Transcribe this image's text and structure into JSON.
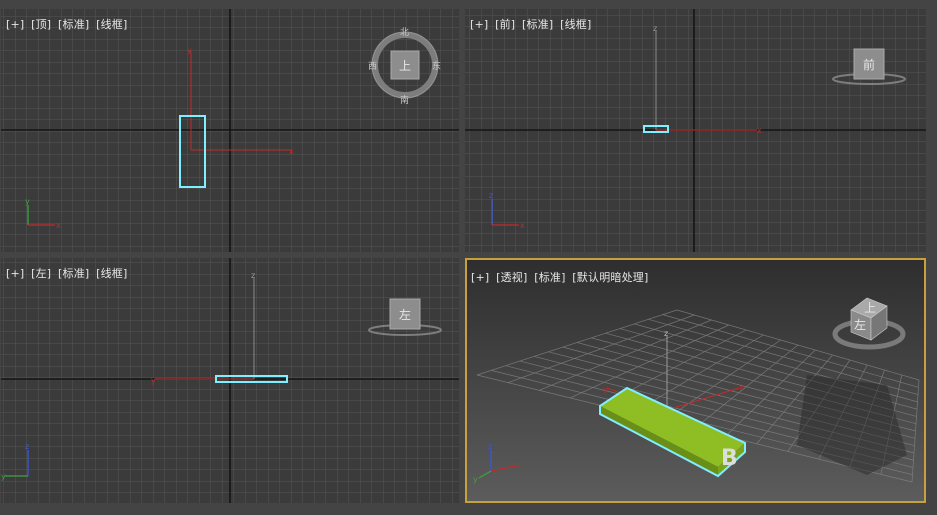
{
  "viewports": {
    "top": {
      "plus": "[+]",
      "view": "[顶]",
      "shading": "[标准]",
      "mode": "[线框]",
      "cube_face": "上",
      "compass": {
        "n": "北",
        "s": "南",
        "e": "东",
        "w": "西"
      }
    },
    "front": {
      "plus": "[+]",
      "view": "[前]",
      "shading": "[标准]",
      "mode": "[线框]",
      "cube_face": "前"
    },
    "left": {
      "plus": "[+]",
      "view": "[左]",
      "shading": "[标准]",
      "mode": "[线框]",
      "cube_face": "左"
    },
    "perspective": {
      "plus": "[+]",
      "view": "[透视]",
      "shading": "[标准]",
      "mode": "[默认明暗处理]",
      "cube_face_front": "左",
      "cube_face_top": "上"
    }
  },
  "axes": {
    "x": "x",
    "y": "y",
    "z": "z"
  },
  "colors": {
    "grid_bg": "#3b3b3b",
    "grid_line": "#555555",
    "selection": "#7fefff",
    "box_fill": "#8fbd24",
    "x_axis": "#c42a2a",
    "y_axis": "#3ea33e",
    "z_axis": "#3a57d6",
    "active_border": "#c8a03c"
  }
}
